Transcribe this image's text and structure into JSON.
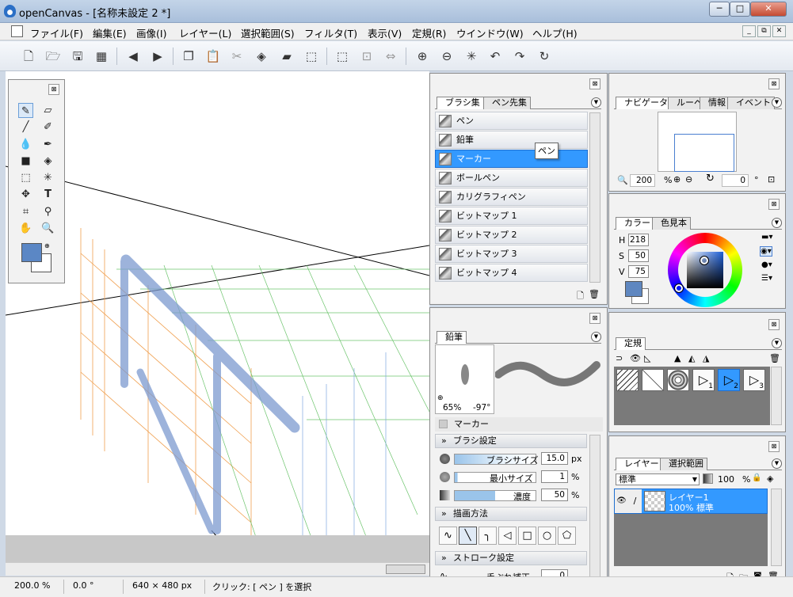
{
  "window": {
    "title": "openCanvas - [名称未設定 2 *]",
    "min": "─",
    "max": "□",
    "close": "✕"
  },
  "menu": [
    "ファイル(F)",
    "編集(E)",
    "画像(I)",
    "レイヤー(L)",
    "選択範囲(S)",
    "フィルタ(T)",
    "表示(V)",
    "定規(R)",
    "ウインドウ(W)",
    "ヘルプ(H)"
  ],
  "mdi": {
    "min": "_",
    "restore": "⧉",
    "close": "✕"
  },
  "toolbar_icons": [
    "new-icon",
    "open-icon",
    "save-icon",
    "save-all-icon",
    "prev-icon",
    "next-icon",
    "copy-icon",
    "paste-icon",
    "cut-icon",
    "fill-icon",
    "eraser-icon",
    "transform-icon",
    "select-rect-icon",
    "deselect-icon",
    "invert-select-icon",
    "zoom-in-icon",
    "zoom-out-icon",
    "reset-icon",
    "undo-icon",
    "redo-icon",
    "redo-all-icon"
  ],
  "toolbox": {
    "close": "⊠",
    "fg_color": "#5b87c5",
    "bg_color": "#ffffff"
  },
  "brush_panel": {
    "tabs": [
      "ブラシ集",
      "ペン先集"
    ],
    "items": [
      "ペン",
      "鉛筆",
      "マーカー",
      "ボールペン",
      "カリグラフィペン",
      "ビットマップ 1",
      "ビットマップ 2",
      "ビットマップ 3",
      "ビットマップ 4"
    ],
    "selected_index": 2,
    "tooltip": "ペン",
    "close": "⊠"
  },
  "brush_settings": {
    "tab": "鉛筆",
    "preview_pct": "65%",
    "preview_angle": "-97°",
    "current_brush": "マーカー",
    "section_brush": "ブラシ設定",
    "size_label": "ブラシサイズ",
    "size_value": "15.0",
    "size_unit": "px",
    "min_label": "最小サイズ",
    "min_value": "1",
    "min_unit": "%",
    "density_label": "濃度",
    "density_value": "50",
    "density_unit": "%",
    "section_draw": "描画方法",
    "section_stroke": "ストローク設定",
    "stabilizer_label": "手ぶれ補正",
    "stabilizer_value": "0",
    "close": "⊠"
  },
  "navigator": {
    "tabs": [
      "ナビゲータ",
      "ルーペ",
      "情報",
      "イベント"
    ],
    "zoom": "200",
    "zoom_unit": "%",
    "angle": "0",
    "angle_unit": "°",
    "close": "⊠"
  },
  "color_panel": {
    "tabs": [
      "カラー",
      "色見本"
    ],
    "h_label": "H",
    "h": "218",
    "s_label": "S",
    "s": "50",
    "v_label": "V",
    "v": "75",
    "current_color": "#5f87c0",
    "close": "⊠"
  },
  "ruler_panel": {
    "tab": "定規",
    "rule_labels": [
      "1",
      "2",
      "3"
    ],
    "close": "⊠"
  },
  "layer_panel": {
    "tabs": [
      "レイヤー",
      "選択範囲"
    ],
    "blend_mode": "標準",
    "opacity": "100",
    "opacity_unit": "%",
    "layers": [
      {
        "name": "レイヤー1",
        "info": "100% 標準"
      }
    ],
    "close": "⊠"
  },
  "status": {
    "zoom": "200.0 %",
    "angle": "0.0 °",
    "size": "640 × 480 px",
    "hint": "クリック: [ ペン ] を選択"
  }
}
